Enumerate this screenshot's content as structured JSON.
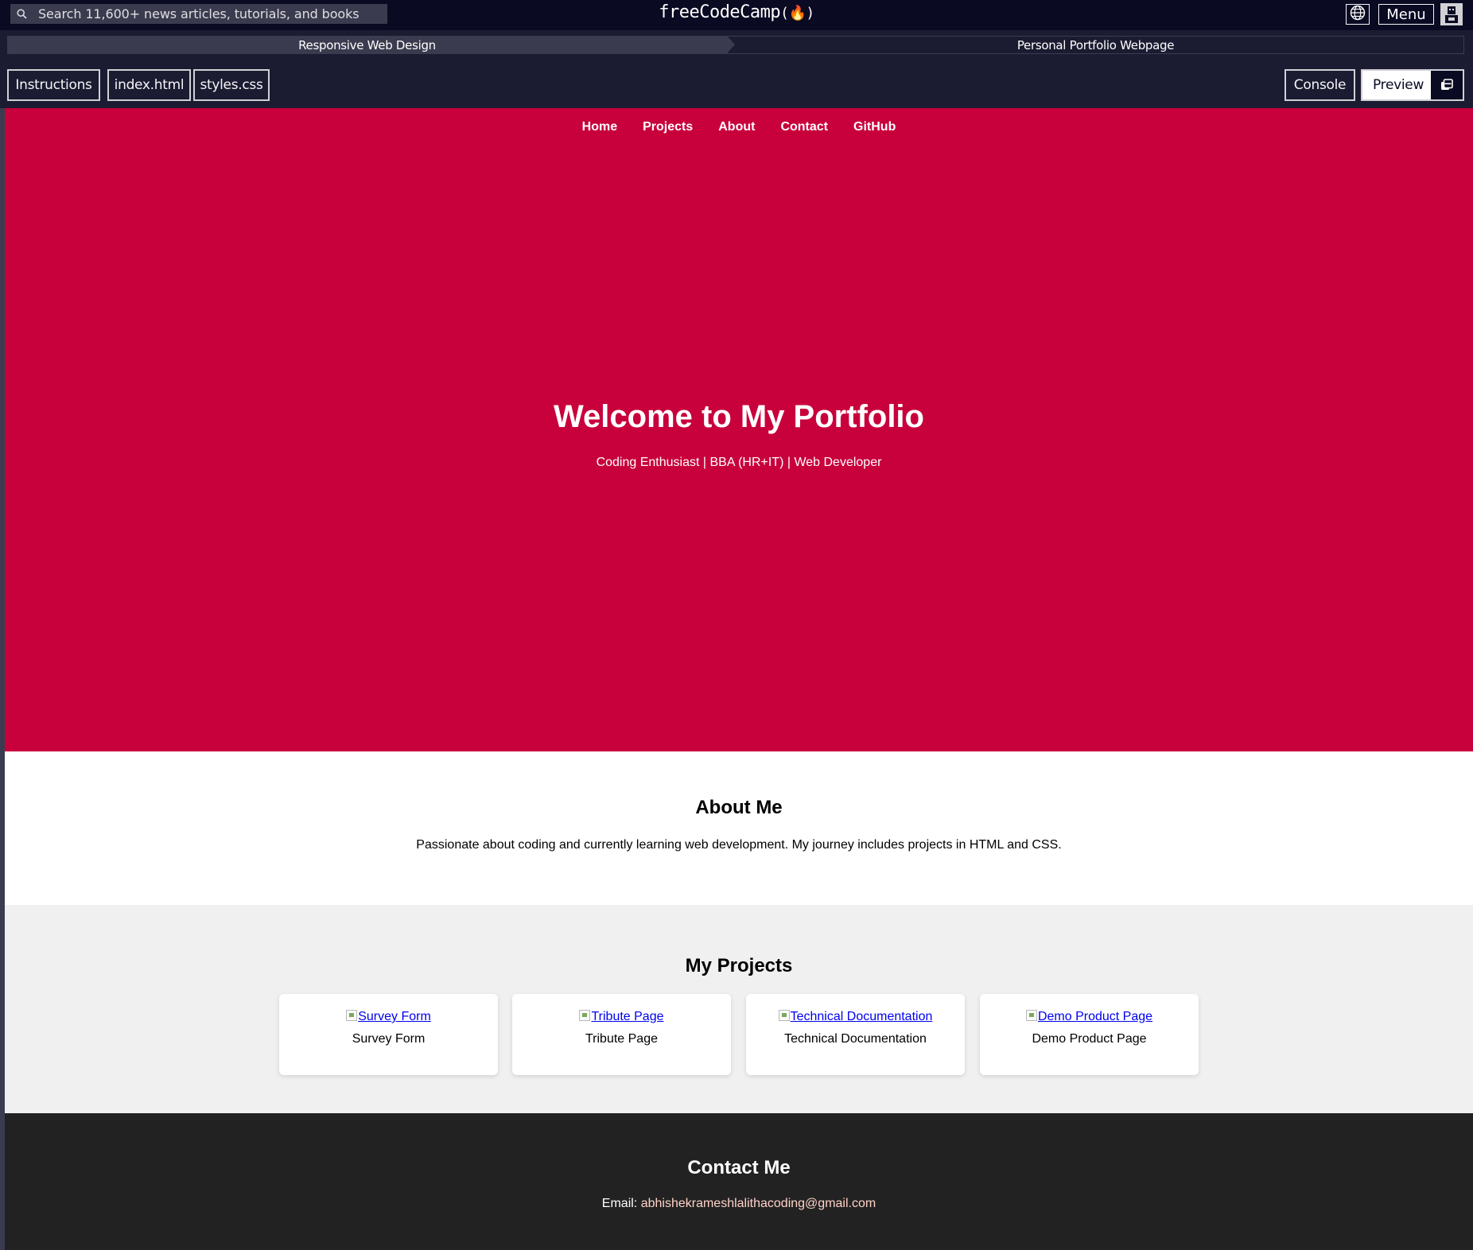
{
  "topnav": {
    "search_placeholder": "Search 11,600+ news articles, tutorials, and books",
    "logo_text": "freeCodeCamp",
    "logo_flame": "(🔥)",
    "menu_label": "Menu"
  },
  "breadcrumb": {
    "superblock": "Responsive Web Design",
    "challenge": "Personal Portfolio Webpage"
  },
  "toolbar": {
    "tabs": [
      "Instructions",
      "index.html",
      "styles.css"
    ],
    "console_label": "Console",
    "preview_label": "Preview"
  },
  "preview": {
    "nav": [
      "Home",
      "Projects",
      "About",
      "Contact",
      "GitHub"
    ],
    "hero": {
      "title": "Welcome to My Portfolio",
      "subtitle": "Coding Enthusiast | BBA (HR+IT) | Web Developer",
      "bg_color": "#c8003c"
    },
    "about": {
      "heading": "About Me",
      "text": "Passionate about coding and currently learning web development. My journey includes projects in HTML and CSS."
    },
    "projects": {
      "heading": "My Projects",
      "items": [
        {
          "alt": "Survey Form",
          "label": "Survey Form"
        },
        {
          "alt": "Tribute Page",
          "label": "Tribute Page"
        },
        {
          "alt": "Technical Documentation",
          "label": "Technical Documentation"
        },
        {
          "alt": "Demo Product Page",
          "label": "Demo Product Page"
        }
      ]
    },
    "contact": {
      "heading": "Contact Me",
      "email_label": "Email:",
      "email": "abhishekrameshlalithacoding@gmail.com"
    }
  },
  "colors": {
    "fcc_dark": "#0a0a23",
    "fcc_gray": "#3b3b4f",
    "footer_bg": "#222222",
    "projects_bg": "#f0f0f0"
  },
  "icons": [
    "search-icon",
    "globe-icon",
    "avatar-icon",
    "external-window-icon",
    "broken-image-icon"
  ]
}
